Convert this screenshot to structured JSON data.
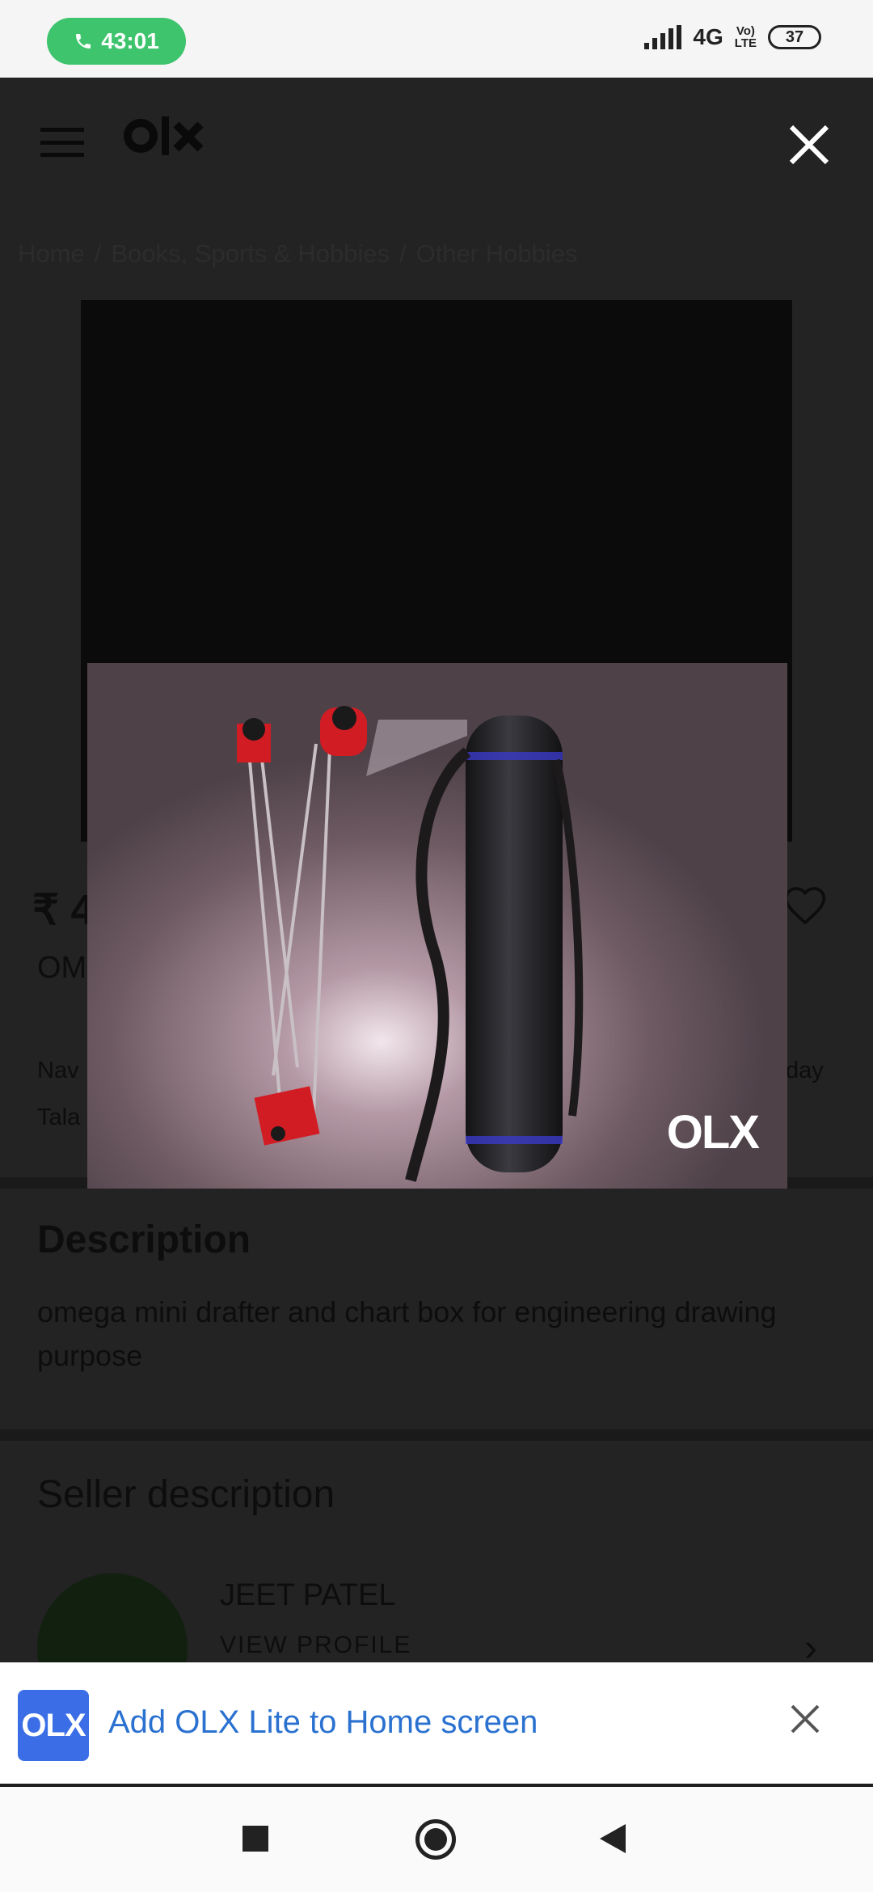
{
  "status_bar": {
    "call_timer": "43:01",
    "network": "4G",
    "volte_top": "Vo)",
    "volte_bottom": "LTE",
    "battery": "37"
  },
  "header": {
    "logo": "OLX",
    "close_icon": "close-icon"
  },
  "breadcrumb": [
    "Home",
    "Books, Sports & Hobbies",
    "Other Hobbies"
  ],
  "listing": {
    "price_fragment": "₹ 4",
    "title_fragment": "OM",
    "location_fragment_1": "Nav",
    "location_fragment_2": "Tala",
    "date_fragment": "day"
  },
  "description": {
    "heading": "Description",
    "text": "omega mini drafter and chart box for engineering drawing purpose"
  },
  "seller": {
    "heading": "Seller description",
    "name": "JEET PATEL",
    "view_profile": "VIEW PROFILE"
  },
  "viewer": {
    "watermark": "OLX"
  },
  "a2hs_banner": {
    "icon_text": "OLX",
    "text": "Add OLX Lite to Home screen"
  },
  "colors": {
    "call_green": "#3ec46d",
    "banner_link": "#2a71d0",
    "olx_blue": "#3b6ee6"
  }
}
